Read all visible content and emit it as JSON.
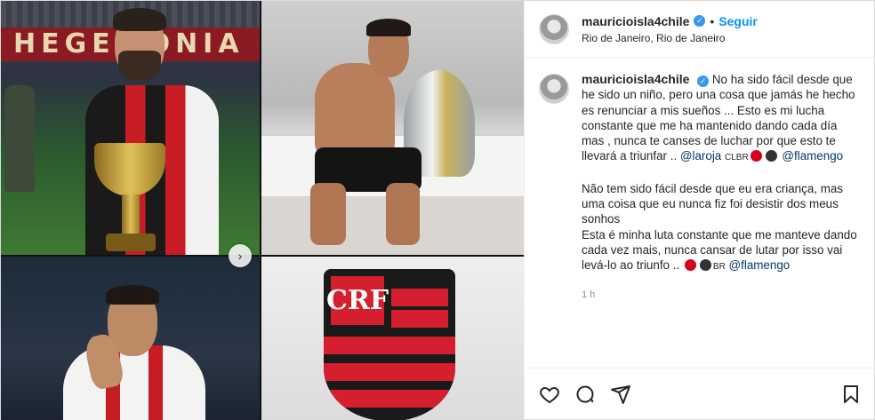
{
  "media": {
    "banner_text": "HEGEMONIA",
    "crest_text": "CRF"
  },
  "header": {
    "username": "mauricioisla4chile",
    "separator": "•",
    "follow_label": "Seguir",
    "location": "Rio de Janeiro, Rio de Janeiro"
  },
  "caption": {
    "username": "mauricioisla4chile",
    "es_lines": "No ha sido fácil desde que he sido un niño, pero una cosa que jamás he hecho es renunciar a mis sueños ... Esto es mi lucha constante que me ha mantenido dando cada día mas , nunca te canses de luchar por que esto te llevará a triunfar ..",
    "es_mention1": "@laroja",
    "es_flag_label": "CLBR",
    "es_mention2": "@flamengo",
    "pt_para1": "Não tem sido fácil desde que eu era criança, mas uma coisa que eu nunca fiz foi desistir dos meus sonhos",
    "pt_para2": "Esta é minha luta constante que me manteve dando cada vez mais, nunca cansar de lutar por isso vai levá-lo ao triunfo ..",
    "pt_flag_label": "BR",
    "pt_mention": "@flamengo",
    "time": "1 h"
  },
  "icons": [
    "heart-icon",
    "comment-icon",
    "share-icon",
    "bookmark-icon",
    "verified-icon",
    "chevron-right-icon"
  ],
  "colors": {
    "link": "#0095f6",
    "mention": "#00376b",
    "verified": "#3897f0",
    "flamengo_red": "#d51f2e"
  }
}
